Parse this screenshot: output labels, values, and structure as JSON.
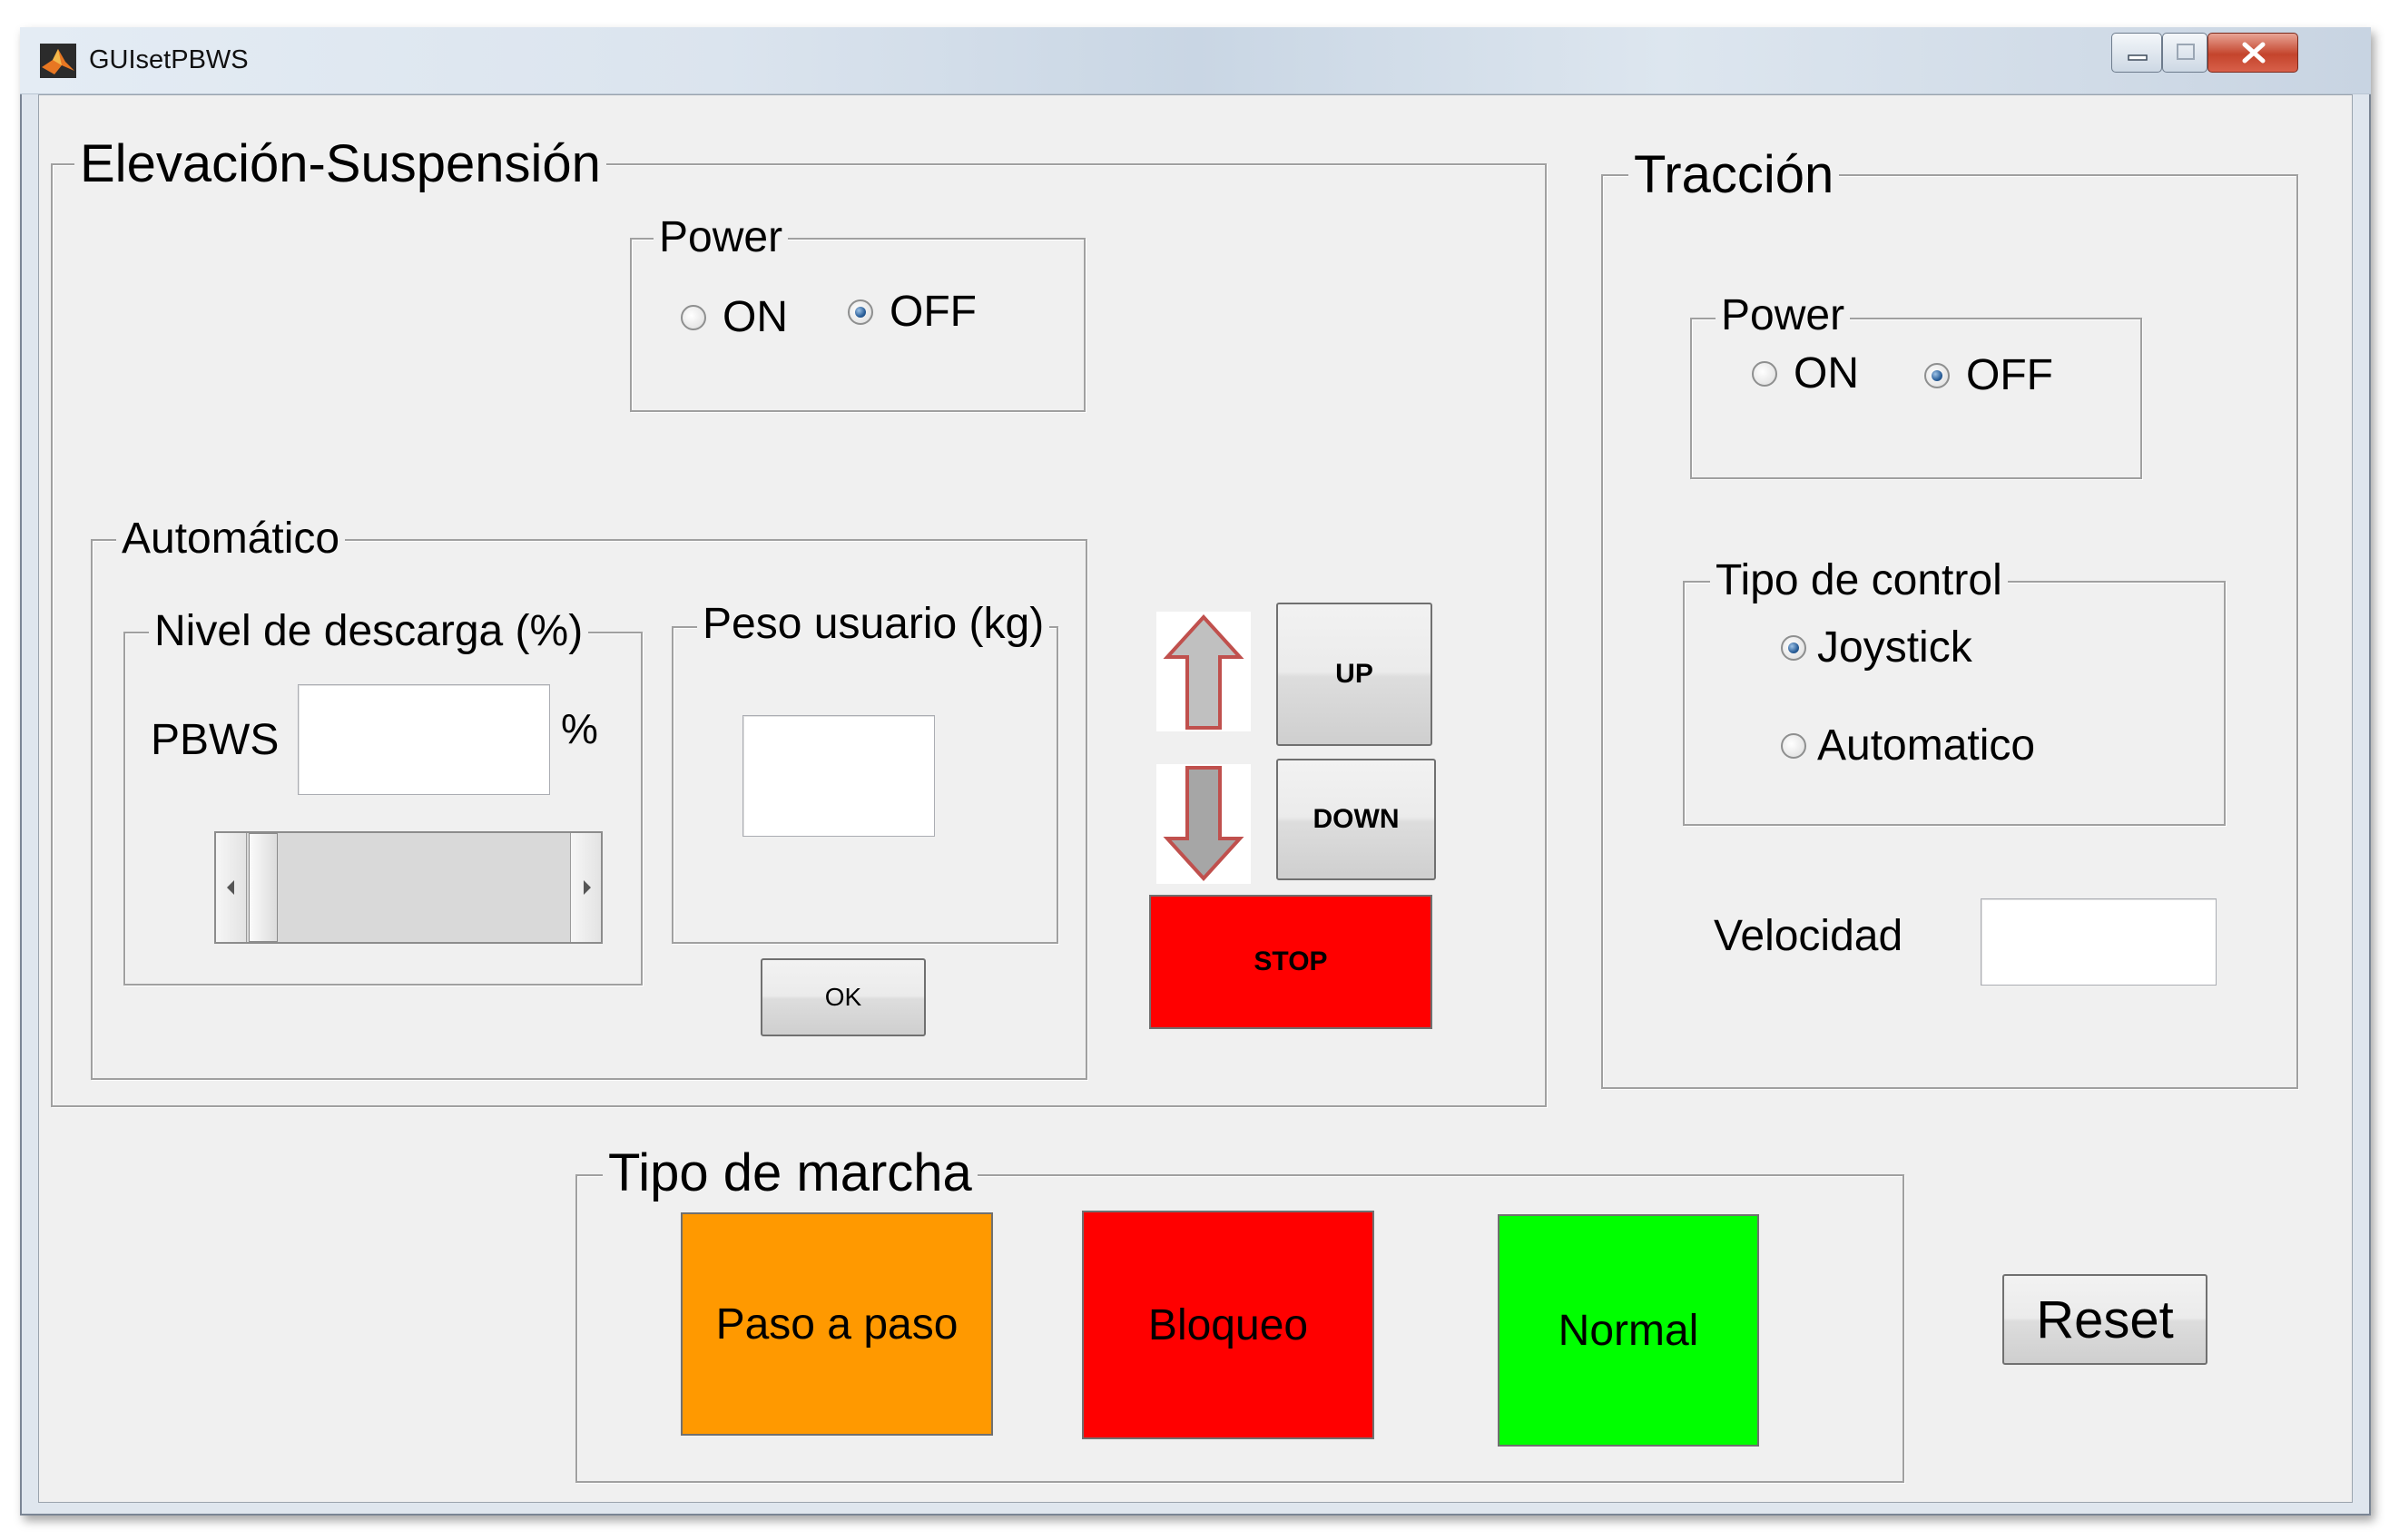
{
  "window": {
    "title": "GUIsetPBWS",
    "app_icon": "matlab-logo-icon",
    "controls": [
      "minimize-icon",
      "maximize-icon",
      "close-icon"
    ]
  },
  "elevacion": {
    "title": "Elevación-Suspensión",
    "power": {
      "title": "Power",
      "on_label": "ON",
      "off_label": "OFF",
      "selected": "OFF"
    },
    "automatico": {
      "title": "Automático",
      "nivel": {
        "title": "Nivel de descarga (%)",
        "pbws_label": "PBWS",
        "pbws_value": "",
        "unit": "%",
        "slider_fraction": 0
      },
      "peso": {
        "title": "Peso usuario (kg)",
        "value": "",
        "ok_label": "OK"
      }
    },
    "up_label": "UP",
    "down_label": "DOWN",
    "stop_label": "STOP",
    "up_icon": "arrow-up-icon",
    "down_icon": "arrow-down-icon"
  },
  "traccion": {
    "title": "Tracción",
    "power": {
      "title": "Power",
      "on_label": "ON",
      "off_label": "OFF",
      "selected": "OFF"
    },
    "tipo_control": {
      "title": "Tipo de control",
      "options": [
        "Joystick",
        "Automatico"
      ],
      "selected": "Joystick"
    },
    "velocidad_label": "Velocidad",
    "velocidad_value": ""
  },
  "marcha": {
    "title": "Tipo de marcha",
    "buttons": [
      {
        "label": "Paso a paso",
        "color": "#ff9900"
      },
      {
        "label": "Bloqueo",
        "color": "#ff0000"
      },
      {
        "label": "Normal",
        "color": "#00ff00"
      }
    ]
  },
  "reset_label": "Reset",
  "colors": {
    "stop": "#ff0000",
    "arrow": "#c0c0c0",
    "arrow_outline": "#c0504d"
  }
}
